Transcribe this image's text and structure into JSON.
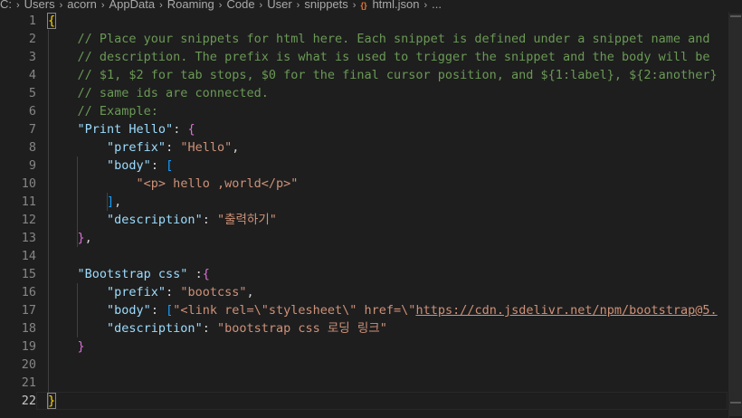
{
  "breadcrumb": {
    "items": [
      "C:",
      "Users",
      "acorn",
      "AppData",
      "Roaming",
      "Code",
      "User",
      "snippets"
    ],
    "file_icon": "{}",
    "file": "html.json",
    "more": "..."
  },
  "editor": {
    "line_numbers": [
      "1",
      "2",
      "3",
      "4",
      "5",
      "6",
      "7",
      "8",
      "9",
      "10",
      "11",
      "12",
      "13",
      "14",
      "15",
      "16",
      "17",
      "18",
      "19",
      "20",
      "21",
      "22"
    ],
    "active_line": 22,
    "code": {
      "l1_open": "{",
      "l2": "    // Place your snippets for html here. Each snippet is defined under a snippet name and",
      "l3": "    // description. The prefix is what is used to trigger the snippet and the body will be",
      "l4": "    // $1, $2 for tab stops, $0 for the final cursor position, and ${1:label}, ${2:another}",
      "l5": "    // same ids are connected.",
      "l6": "    // Example:",
      "l7_key": "\"Print Hello\"",
      "l7_colon": ": ",
      "l7_brace": "{",
      "l8_key": "\"prefix\"",
      "l8_val": "\"Hello\"",
      "l9_key": "\"body\"",
      "l9_bracket": "[",
      "l10_val": "\"<p> hello ,world</p>\"",
      "l11_bracket": "]",
      "l12_key": "\"description\"",
      "l12_val": "\"출력하기\"",
      "l13_brace": "}",
      "l15_key": "\"Bootstrap css\"",
      "l15_colon": " :",
      "l15_brace": "{",
      "l16_key": "\"prefix\"",
      "l16_val": "\"bootcss\"",
      "l17_key": "\"body\"",
      "l17_bracket": "[",
      "l17_val_a": "\"<link rel=\\\"stylesheet\\\" href=\\\"",
      "l17_url": "https://cdn.jsdelivr.net/npm/bootstrap@5.",
      "l18_key": "\"description\"",
      "l18_val": "\"bootstrap css 로딩 링크\"",
      "l19_brace": "}",
      "l22_close": "}"
    }
  },
  "colors": {
    "background": "#1e1e1e",
    "comment": "#6a9955",
    "key": "#9cdcfe",
    "string": "#ce9178",
    "bracket_level1": "#ffd700",
    "bracket_level2": "#da70d6",
    "bracket_level3": "#179fff"
  }
}
